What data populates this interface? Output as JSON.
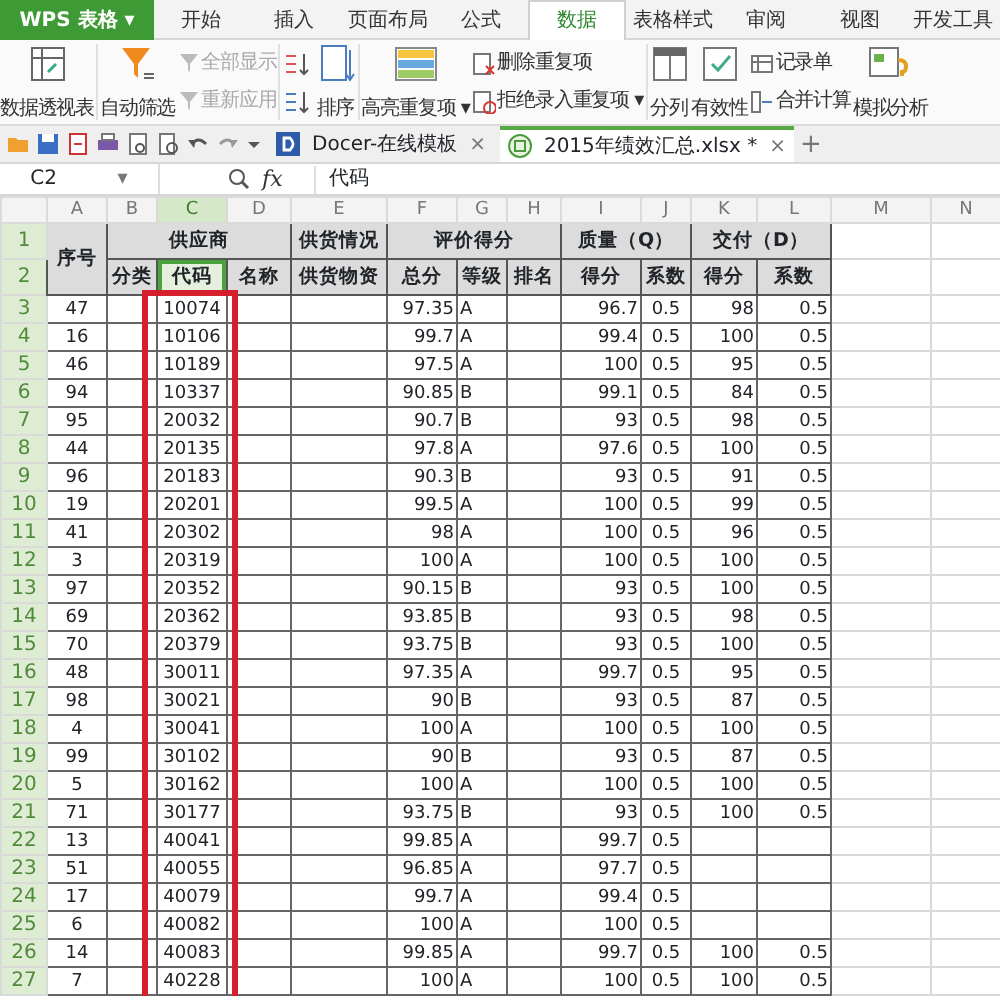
{
  "app": {
    "logo": "WPS 表格",
    "menu_arrow": "▾"
  },
  "tabs": [
    {
      "label": "开始",
      "selected": false
    },
    {
      "label": "插入",
      "selected": false
    },
    {
      "label": "页面布局",
      "selected": false
    },
    {
      "label": "公式",
      "selected": false
    },
    {
      "label": "数据",
      "selected": true
    },
    {
      "label": "表格样式",
      "selected": false
    },
    {
      "label": "审阅",
      "selected": false
    },
    {
      "label": "视图",
      "selected": false
    },
    {
      "label": "开发工具",
      "selected": false
    }
  ],
  "ribbon": [
    {
      "kind": "large",
      "label": "数据透视表",
      "disabled": false
    },
    {
      "kind": "large",
      "label": "自动筛选",
      "disabled": false
    },
    {
      "kind": "stack",
      "items": [
        {
          "label": "全部显示",
          "disabled": true
        },
        {
          "label": "重新应用",
          "disabled": true
        }
      ]
    },
    {
      "kind": "sort",
      "label": "排序",
      "disabled": false
    },
    {
      "kind": "large",
      "label": "高亮重复项",
      "disabled": false,
      "dropdown_arrow": "▾"
    },
    {
      "kind": "stack",
      "items": [
        {
          "label": "删除重复项",
          "disabled": false
        },
        {
          "label": "拒绝录入重复项",
          "disabled": false,
          "dropdown_arrow": "▾"
        }
      ]
    },
    {
      "kind": "large",
      "label": "分列",
      "disabled": false
    },
    {
      "kind": "large",
      "label": "有效性",
      "disabled": false
    },
    {
      "kind": "stack",
      "items": [
        {
          "label": "记录单",
          "disabled": false
        },
        {
          "label": "合并计算",
          "disabled": false
        }
      ]
    },
    {
      "kind": "large",
      "label": "模拟分析",
      "disabled": false
    }
  ],
  "documents": [
    {
      "title": "Docer-在线模板",
      "close": "×",
      "selected": false
    },
    {
      "title": "2015年绩效汇总.xlsx *",
      "close": "×",
      "selected": true
    }
  ],
  "new_tab": "+",
  "formula_bar": {
    "name_box": "C2",
    "name_box_arrow": "▾",
    "fx": "fx",
    "value": "代码"
  },
  "sheet": {
    "columns": [
      {
        "letter": "A",
        "selected": false
      },
      {
        "letter": "B",
        "selected": false
      },
      {
        "letter": "C",
        "selected": true
      },
      {
        "letter": "D",
        "selected": false
      },
      {
        "letter": "E",
        "selected": false
      },
      {
        "letter": "F",
        "selected": false
      },
      {
        "letter": "G",
        "selected": false
      },
      {
        "letter": "H",
        "selected": false
      },
      {
        "letter": "I",
        "selected": false
      },
      {
        "letter": "J",
        "selected": false
      },
      {
        "letter": "K",
        "selected": false
      },
      {
        "letter": "L",
        "selected": false
      },
      {
        "letter": "M",
        "selected": false
      },
      {
        "letter": "N",
        "selected": false
      }
    ],
    "header_rows": [
      {
        "number": "1",
        "selected": true,
        "cells": [
          {
            "text": "序号",
            "rowspan": 2,
            "selected": false
          },
          {
            "text": "供应商",
            "colspan": 3,
            "selected": false
          },
          {
            "text": "供货情况",
            "selected": false
          },
          {
            "text": "评价得分",
            "colspan": 3,
            "selected": false
          },
          {
            "text": "质量（Q）",
            "colspan": 2,
            "selected": false
          },
          {
            "text": "交付（D）",
            "colspan": 2,
            "selected": false
          }
        ]
      },
      {
        "number": "2",
        "selected": true,
        "cells": [
          {
            "text": "分类",
            "selected": false
          },
          {
            "text": "代码",
            "selected": true
          },
          {
            "text": "名称",
            "selected": false
          },
          {
            "text": "供货物资",
            "selected": false
          },
          {
            "text": "总分",
            "selected": false
          },
          {
            "text": "等级",
            "selected": false
          },
          {
            "text": "排名",
            "selected": false
          },
          {
            "text": "得分",
            "selected": false
          },
          {
            "text": "系数",
            "selected": false
          },
          {
            "text": "得分",
            "selected": false
          },
          {
            "text": "系数",
            "selected": false
          }
        ]
      }
    ],
    "rows": [
      {
        "number": "3",
        "selected": true,
        "A": "47",
        "C": "10074",
        "F": "97.35",
        "G": "A",
        "I": "96.7",
        "J": "0.5",
        "K": "98",
        "L": "0.5"
      },
      {
        "number": "4",
        "selected": true,
        "A": "16",
        "C": "10106",
        "F": "99.7",
        "G": "A",
        "I": "99.4",
        "J": "0.5",
        "K": "100",
        "L": "0.5"
      },
      {
        "number": "5",
        "selected": true,
        "A": "46",
        "C": "10189",
        "F": "97.5",
        "G": "A",
        "I": "100",
        "J": "0.5",
        "K": "95",
        "L": "0.5"
      },
      {
        "number": "6",
        "selected": true,
        "A": "94",
        "C": "10337",
        "F": "90.85",
        "G": "B",
        "I": "99.1",
        "J": "0.5",
        "K": "84",
        "L": "0.5"
      },
      {
        "number": "7",
        "selected": true,
        "A": "95",
        "C": "20032",
        "F": "90.7",
        "G": "B",
        "I": "93",
        "J": "0.5",
        "K": "98",
        "L": "0.5"
      },
      {
        "number": "8",
        "selected": true,
        "A": "44",
        "C": "20135",
        "F": "97.8",
        "G": "A",
        "I": "97.6",
        "J": "0.5",
        "K": "100",
        "L": "0.5"
      },
      {
        "number": "9",
        "selected": true,
        "A": "96",
        "C": "20183",
        "F": "90.3",
        "G": "B",
        "I": "93",
        "J": "0.5",
        "K": "91",
        "L": "0.5"
      },
      {
        "number": "10",
        "selected": true,
        "A": "19",
        "C": "20201",
        "F": "99.5",
        "G": "A",
        "I": "100",
        "J": "0.5",
        "K": "99",
        "L": "0.5"
      },
      {
        "number": "11",
        "selected": true,
        "A": "41",
        "C": "20302",
        "F": "98",
        "G": "A",
        "I": "100",
        "J": "0.5",
        "K": "96",
        "L": "0.5"
      },
      {
        "number": "12",
        "selected": true,
        "A": "3",
        "C": "20319",
        "F": "100",
        "G": "A",
        "I": "100",
        "J": "0.5",
        "K": "100",
        "L": "0.5"
      },
      {
        "number": "13",
        "selected": true,
        "A": "97",
        "C": "20352",
        "F": "90.15",
        "G": "B",
        "I": "93",
        "J": "0.5",
        "K": "100",
        "L": "0.5"
      },
      {
        "number": "14",
        "selected": true,
        "A": "69",
        "C": "20362",
        "F": "93.85",
        "G": "B",
        "I": "93",
        "J": "0.5",
        "K": "98",
        "L": "0.5"
      },
      {
        "number": "15",
        "selected": true,
        "A": "70",
        "C": "20379",
        "F": "93.75",
        "G": "B",
        "I": "93",
        "J": "0.5",
        "K": "100",
        "L": "0.5"
      },
      {
        "number": "16",
        "selected": true,
        "A": "48",
        "C": "30011",
        "F": "97.35",
        "G": "A",
        "I": "99.7",
        "J": "0.5",
        "K": "95",
        "L": "0.5"
      },
      {
        "number": "17",
        "selected": true,
        "A": "98",
        "C": "30021",
        "F": "90",
        "G": "B",
        "I": "93",
        "J": "0.5",
        "K": "87",
        "L": "0.5"
      },
      {
        "number": "18",
        "selected": true,
        "A": "4",
        "C": "30041",
        "F": "100",
        "G": "A",
        "I": "100",
        "J": "0.5",
        "K": "100",
        "L": "0.5"
      },
      {
        "number": "19",
        "selected": true,
        "A": "99",
        "C": "30102",
        "F": "90",
        "G": "B",
        "I": "93",
        "J": "0.5",
        "K": "87",
        "L": "0.5"
      },
      {
        "number": "20",
        "selected": true,
        "A": "5",
        "C": "30162",
        "F": "100",
        "G": "A",
        "I": "100",
        "J": "0.5",
        "K": "100",
        "L": "0.5"
      },
      {
        "number": "21",
        "selected": true,
        "A": "71",
        "C": "30177",
        "F": "93.75",
        "G": "B",
        "I": "93",
        "J": "0.5",
        "K": "100",
        "L": "0.5"
      },
      {
        "number": "22",
        "selected": true,
        "A": "13",
        "C": "40041",
        "F": "99.85",
        "G": "A",
        "I": "99.7",
        "J": "0.5"
      },
      {
        "number": "23",
        "selected": true,
        "A": "51",
        "C": "40055",
        "F": "96.85",
        "G": "A",
        "I": "97.7",
        "J": "0.5"
      },
      {
        "number": "24",
        "selected": true,
        "A": "17",
        "C": "40079",
        "F": "99.7",
        "G": "A",
        "I": "99.4",
        "J": "0.5"
      },
      {
        "number": "25",
        "selected": true,
        "A": "6",
        "C": "40082",
        "F": "100",
        "G": "A",
        "I": "100",
        "J": "0.5"
      },
      {
        "number": "26",
        "selected": true,
        "A": "14",
        "C": "40083",
        "F": "99.85",
        "G": "A",
        "I": "99.7",
        "J": "0.5",
        "K": "100",
        "L": "0.5"
      },
      {
        "number": "27",
        "selected": true,
        "A": "7",
        "C": "40228",
        "F": "100",
        "G": "A",
        "I": "100",
        "J": "0.5",
        "K": "100",
        "L": "0.5"
      }
    ]
  }
}
